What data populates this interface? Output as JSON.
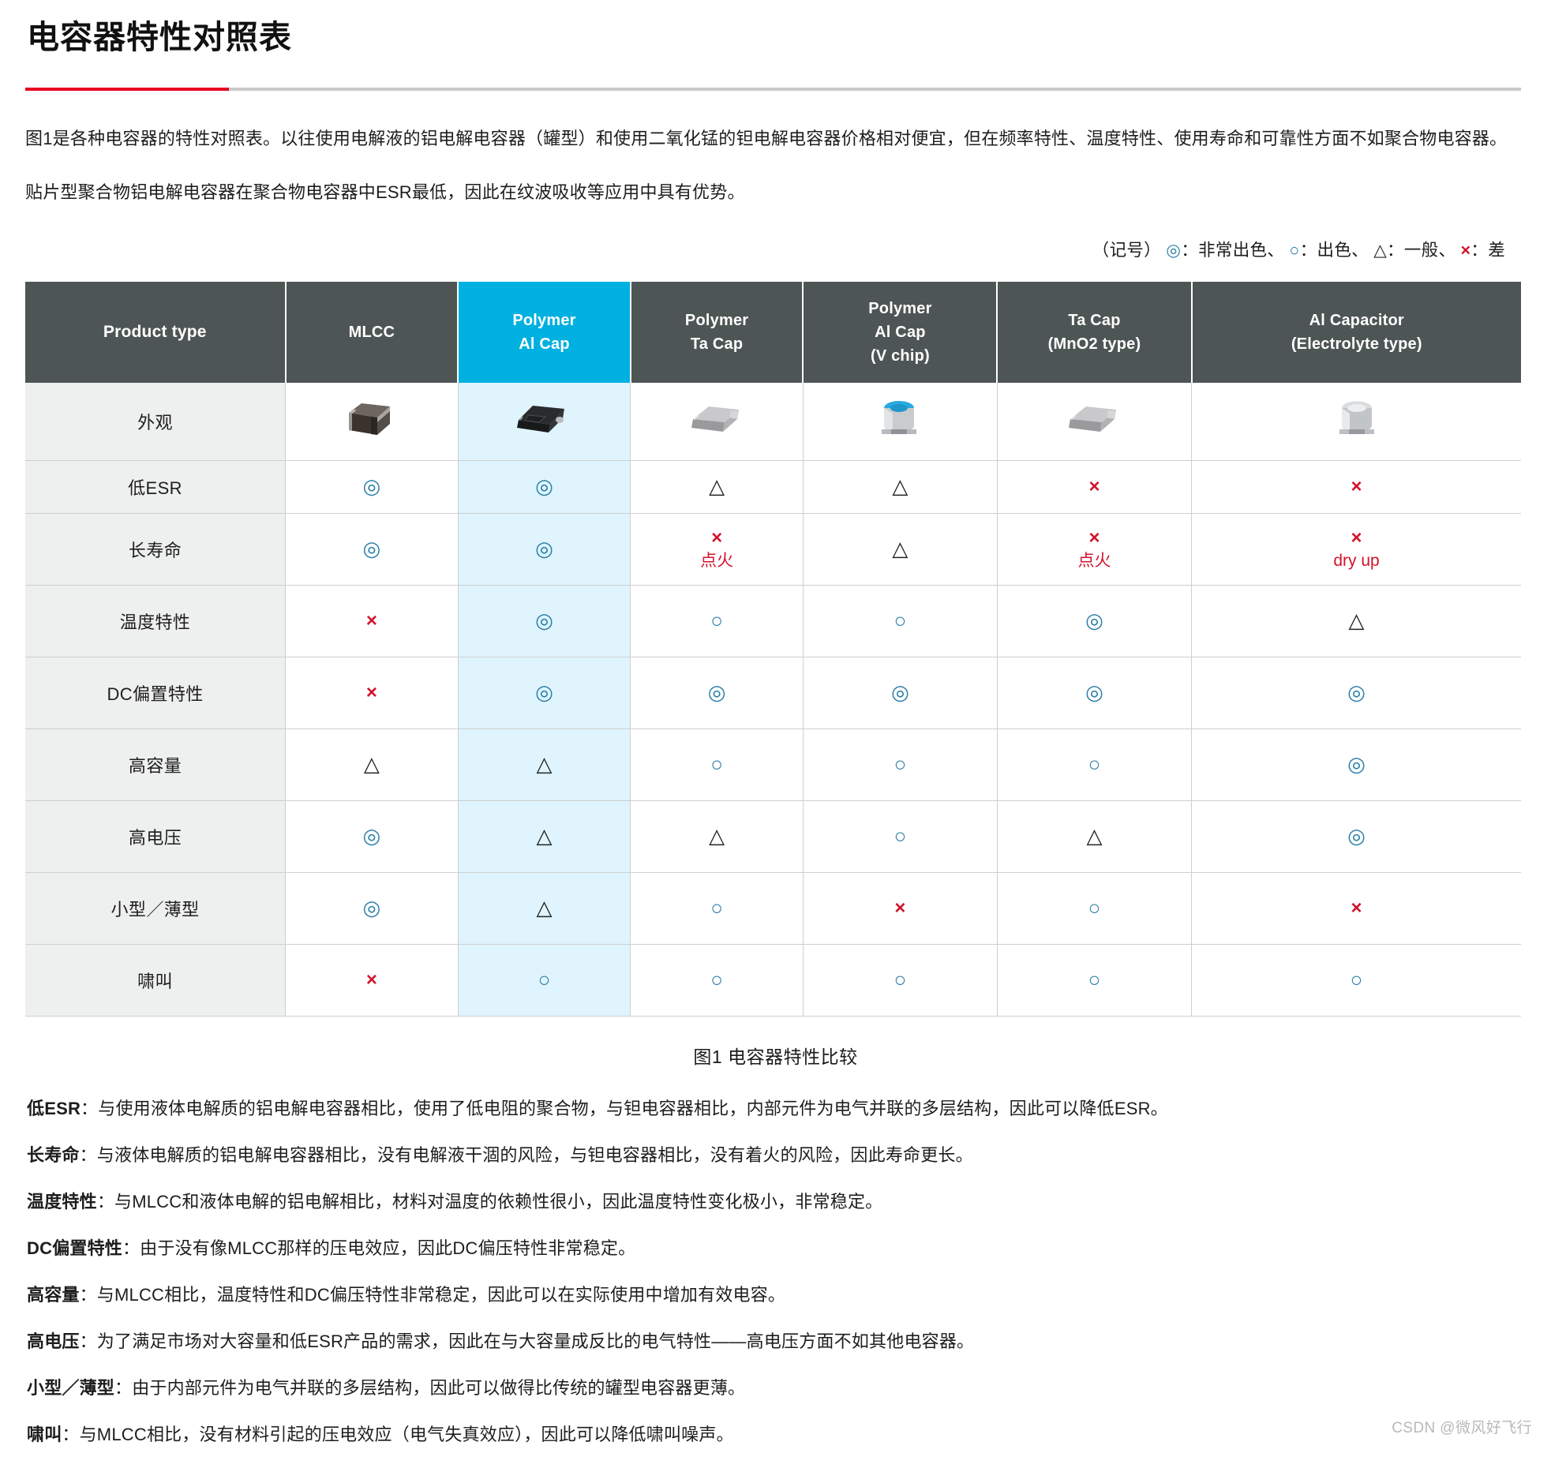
{
  "document": {
    "title": "电容器特性对照表",
    "accent_color": "#e60020",
    "intro_paragraph_1": "图1是各种电容器的特性对照表。以往使用电解液的铝电解电容器（罐型）和使用二氧化锰的钽电解电容器价格相对便宜，但在频率特性、温度特性、使用寿命和可靠性方面不如聚合物电容器。",
    "intro_paragraph_2": "贴片型聚合物铝电解电容器在聚合物电容器中ESR最低，因此在纹波吸收等应用中具有优势。",
    "figure_caption": "图1 电容器特性比较",
    "watermark": "CSDN @微风好飞行"
  },
  "legend": {
    "prefix": "（记号）",
    "items": [
      {
        "symbol": "◎",
        "label": "：非常出色、"
      },
      {
        "symbol": "○",
        "label": "：出色、"
      },
      {
        "symbol": "△",
        "label": "：一般、"
      },
      {
        "symbol": "×",
        "label": "：差"
      }
    ]
  },
  "table": {
    "header_accent_color": "#00b0e0",
    "header_bg_color": "#4e5655",
    "highlight_column_index": 2,
    "columns": [
      {
        "label": "Product type",
        "lines": [
          "Product type"
        ]
      },
      {
        "label": "MLCC",
        "lines": [
          "MLCC"
        ]
      },
      {
        "label": "Polymer Al Cap",
        "lines": [
          "Polymer",
          "Al Cap"
        ]
      },
      {
        "label": "Polymer Ta Cap",
        "lines": [
          "Polymer",
          "Ta Cap"
        ]
      },
      {
        "label": "Polymer Al Cap (V chip)",
        "lines": [
          "Polymer",
          "Al Cap",
          "(V chip)"
        ]
      },
      {
        "label": "Ta Cap (MnO2 type)",
        "lines": [
          "Ta Cap",
          "(MnO2 type)"
        ]
      },
      {
        "label": "Al Capacitor (Electrolyte type)",
        "lines": [
          "Al Capacitor",
          "(Electrolyte type)"
        ]
      }
    ],
    "rows": [
      {
        "label": "外观",
        "type": "image",
        "cells": [
          {
            "icon": "mlcc-chip-icon"
          },
          {
            "icon": "polymer-al-cap-chip-icon"
          },
          {
            "icon": "polymer-ta-cap-chip-icon"
          },
          {
            "icon": "polymer-al-cap-vchip-icon"
          },
          {
            "icon": "ta-cap-mno2-chip-icon"
          },
          {
            "icon": "al-capacitor-can-icon"
          }
        ]
      },
      {
        "label": "低ESR",
        "type": "rating",
        "cells": [
          {
            "symbol": "◎"
          },
          {
            "symbol": "◎"
          },
          {
            "symbol": "△"
          },
          {
            "symbol": "△"
          },
          {
            "symbol": "×"
          },
          {
            "symbol": "×"
          }
        ]
      },
      {
        "label": "长寿命",
        "type": "rating",
        "cells": [
          {
            "symbol": "◎"
          },
          {
            "symbol": "◎"
          },
          {
            "symbol": "×",
            "note": "点火"
          },
          {
            "symbol": "△"
          },
          {
            "symbol": "×",
            "note": "点火"
          },
          {
            "symbol": "×",
            "note": "dry up"
          }
        ]
      },
      {
        "label": "温度特性",
        "type": "rating",
        "cells": [
          {
            "symbol": "×"
          },
          {
            "symbol": "◎"
          },
          {
            "symbol": "○"
          },
          {
            "symbol": "○"
          },
          {
            "symbol": "◎"
          },
          {
            "symbol": "△"
          }
        ]
      },
      {
        "label": "DC偏置特性",
        "type": "rating",
        "cells": [
          {
            "symbol": "×"
          },
          {
            "symbol": "◎"
          },
          {
            "symbol": "◎"
          },
          {
            "symbol": "◎"
          },
          {
            "symbol": "◎"
          },
          {
            "symbol": "◎"
          }
        ]
      },
      {
        "label": "高容量",
        "type": "rating",
        "cells": [
          {
            "symbol": "△"
          },
          {
            "symbol": "△"
          },
          {
            "symbol": "○"
          },
          {
            "symbol": "○"
          },
          {
            "symbol": "○"
          },
          {
            "symbol": "◎"
          }
        ]
      },
      {
        "label": "高电压",
        "type": "rating",
        "cells": [
          {
            "symbol": "◎"
          },
          {
            "symbol": "△"
          },
          {
            "symbol": "△"
          },
          {
            "symbol": "○"
          },
          {
            "symbol": "△"
          },
          {
            "symbol": "◎"
          }
        ]
      },
      {
        "label": "小型／薄型",
        "type": "rating",
        "cells": [
          {
            "symbol": "◎"
          },
          {
            "symbol": "△"
          },
          {
            "symbol": "○"
          },
          {
            "symbol": "×"
          },
          {
            "symbol": "○"
          },
          {
            "symbol": "×"
          }
        ]
      },
      {
        "label": "啸叫",
        "type": "rating",
        "cells": [
          {
            "symbol": "×"
          },
          {
            "symbol": "○"
          },
          {
            "symbol": "○"
          },
          {
            "symbol": "○"
          },
          {
            "symbol": "○"
          },
          {
            "symbol": "○"
          }
        ]
      }
    ]
  },
  "notes": [
    {
      "term": "低ESR",
      "text": "：与使用液体电解质的铝电解电容器相比，使用了低电阻的聚合物，与钽电容器相比，内部元件为电气并联的多层结构，因此可以降低ESR。"
    },
    {
      "term": "长寿命",
      "text": "：与液体电解质的铝电解电容器相比，没有电解液干涸的风险，与钽电容器相比，没有着火的风险，因此寿命更长。"
    },
    {
      "term": "温度特性",
      "text": "：与MLCC和液体电解的铝电解相比，材料对温度的依赖性很小，因此温度特性变化极小，非常稳定。"
    },
    {
      "term": "DC偏置特性",
      "text": "：由于没有像MLCC那样的压电效应，因此DC偏压特性非常稳定。"
    },
    {
      "term": "高容量",
      "text": "：与MLCC相比，温度特性和DC偏压特性非常稳定，因此可以在实际使用中增加有效电容。"
    },
    {
      "term": "高电压",
      "text": "：为了满足市场对大容量和低ESR产品的需求，因此在与大容量成反比的电气特性——高电压方面不如其他电容器。"
    },
    {
      "term": "小型／薄型",
      "text": "：由于内部元件为电气并联的多层结构，因此可以做得比传统的罐型电容器更薄。"
    },
    {
      "term": "啸叫",
      "text": "：与MLCC相比，没有材料引起的压电效应（电气失真效应），因此可以降低啸叫噪声。"
    }
  ]
}
